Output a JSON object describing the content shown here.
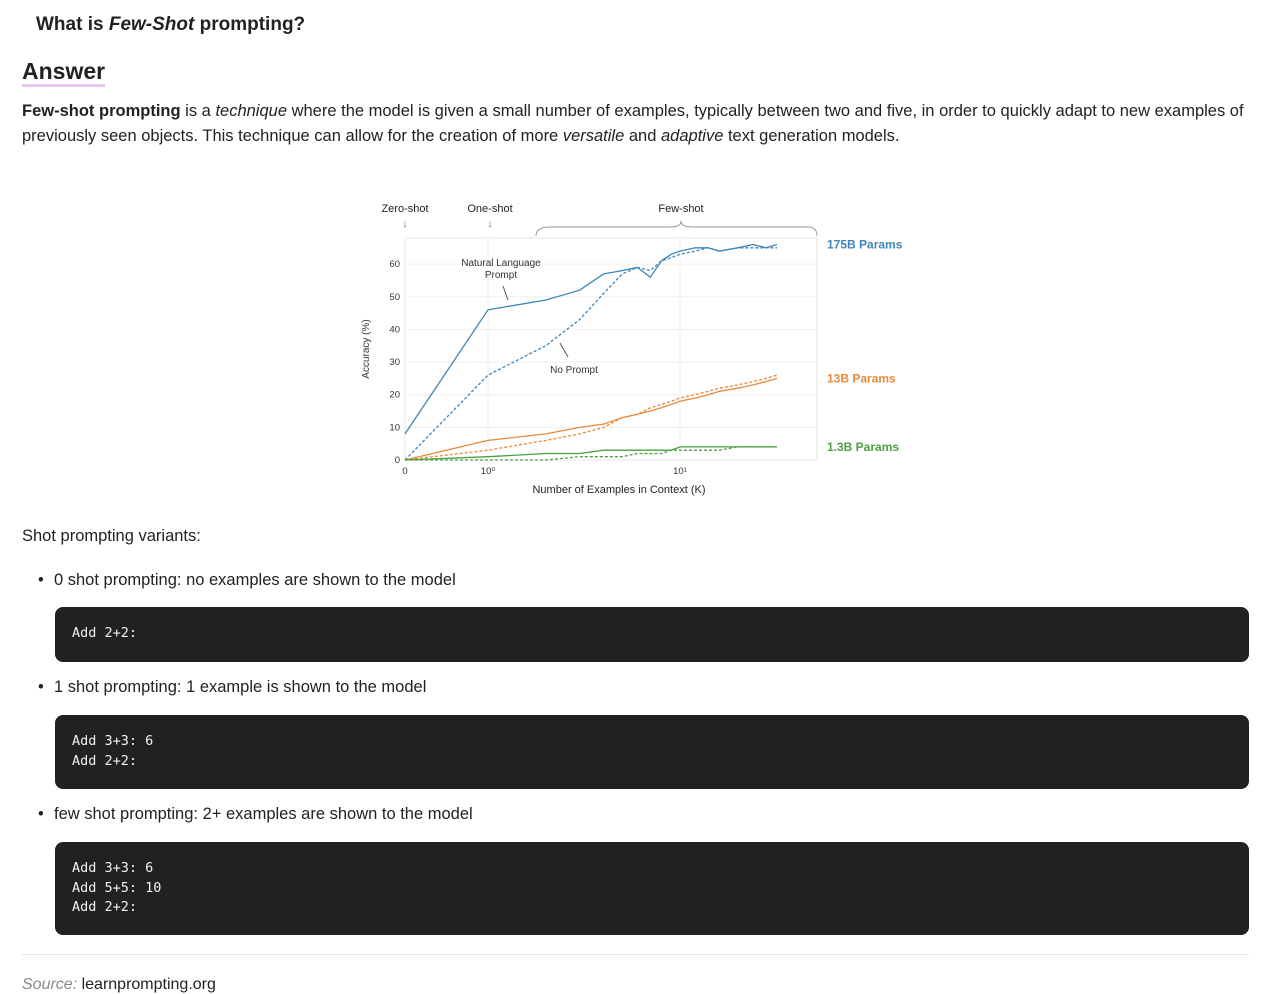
{
  "question": {
    "prefix": "What is ",
    "emphasis": "Few-Shot",
    "suffix": " prompting?"
  },
  "answer_heading": "Answer",
  "answer": {
    "p1_bold": "Few-shot prompting",
    "p1_a": " is a ",
    "p1_italic": "technique",
    "p1_b": " where the model is given a small number of examples, typically between two and five, in order to quickly adapt to new examples of previously seen objects. This technique can allow for the creation of more ",
    "p1_italic2": "versatile",
    "p1_c": " and ",
    "p1_italic3": "adaptive",
    "p1_d": " text generation models."
  },
  "chart_data": {
    "type": "line",
    "xlabel": "Number of Examples in Context (K)",
    "ylabel": "Accuracy (%)",
    "ylim": [
      0,
      68
    ],
    "x_scale": "log",
    "x_tick_labels": [
      "0",
      "10⁰",
      "10¹"
    ],
    "y_ticks": [
      0,
      10,
      20,
      30,
      40,
      50,
      60
    ],
    "top_labels": [
      "Zero-shot",
      "One-shot",
      "Few-shot"
    ],
    "annotations": [
      "Natural Language Prompt",
      "No Prompt"
    ],
    "series": [
      {
        "name": "175B Params",
        "color": "#3d85b8",
        "style": "solid",
        "x": [
          0,
          1,
          2,
          3,
          4,
          5,
          6,
          7,
          8,
          9,
          10,
          12,
          14,
          16,
          20,
          24,
          28,
          32
        ],
        "y": [
          8,
          46,
          49,
          52,
          57,
          58,
          59,
          56,
          61,
          63,
          64,
          65,
          65,
          64,
          65,
          66,
          65,
          66
        ]
      },
      {
        "name": "175B Params (no prompt)",
        "color": "#3d85b8",
        "style": "dashed",
        "x": [
          0,
          1,
          2,
          3,
          4,
          5,
          6,
          7,
          8,
          9,
          10,
          12,
          14,
          16,
          20,
          24,
          28,
          32
        ],
        "y": [
          0,
          26,
          35,
          43,
          51,
          57,
          59,
          58,
          61,
          62,
          63,
          64,
          65,
          64,
          65,
          65,
          65,
          65
        ]
      },
      {
        "name": "13B Params",
        "color": "#e8893a",
        "style": "solid",
        "x": [
          0,
          1,
          2,
          3,
          4,
          5,
          6,
          7,
          8,
          9,
          10,
          12,
          14,
          16,
          20,
          24,
          28,
          32
        ],
        "y": [
          0,
          6,
          8,
          10,
          11,
          13,
          14,
          15,
          16,
          17,
          18,
          19,
          20,
          21,
          22,
          23,
          24,
          25
        ]
      },
      {
        "name": "13B Params (no prompt)",
        "color": "#e8893a",
        "style": "dashed",
        "x": [
          0,
          1,
          2,
          3,
          4,
          5,
          6,
          7,
          8,
          9,
          10,
          12,
          14,
          16,
          20,
          24,
          28,
          32
        ],
        "y": [
          0,
          3,
          6,
          8,
          10,
          13,
          14,
          16,
          17,
          18,
          19,
          20,
          21,
          22,
          23,
          24,
          25,
          26
        ]
      },
      {
        "name": "1.3B Params",
        "color": "#4aa03f",
        "style": "solid",
        "x": [
          0,
          1,
          2,
          3,
          4,
          5,
          6,
          7,
          8,
          9,
          10,
          12,
          14,
          16,
          20,
          24,
          28,
          32
        ],
        "y": [
          0,
          1,
          2,
          2,
          3,
          3,
          3,
          3,
          3,
          3,
          4,
          4,
          4,
          4,
          4,
          4,
          4,
          4
        ]
      },
      {
        "name": "1.3B Params (no prompt)",
        "color": "#4aa03f",
        "style": "dashed",
        "x": [
          0,
          1,
          2,
          3,
          4,
          5,
          6,
          7,
          8,
          9,
          10,
          12,
          14,
          16,
          20,
          24,
          28,
          32
        ],
        "y": [
          0,
          0,
          0,
          1,
          1,
          1,
          2,
          2,
          2,
          3,
          3,
          3,
          3,
          3,
          4,
          4,
          4,
          4
        ]
      }
    ],
    "series_labels": [
      {
        "text": "175B Params",
        "color": "#3d85b8"
      },
      {
        "text": "13B Params",
        "color": "#e8893a"
      },
      {
        "text": "1.3B Params",
        "color": "#4aa03f"
      }
    ]
  },
  "variants_title": "Shot prompting variants:",
  "variants": [
    {
      "label": "0 shot prompting: no examples are shown to the model",
      "code": [
        "Add 2+2:"
      ]
    },
    {
      "label": "1 shot prompting: 1 example is shown to the model",
      "code": [
        "Add 3+3: 6",
        "Add 2+2:"
      ]
    },
    {
      "label": "few shot prompting: 2+ examples are shown to the model",
      "code": [
        "Add 3+3: 6",
        "Add 5+5: 10",
        "Add 2+2:"
      ]
    }
  ],
  "source": {
    "label": "Source: ",
    "value": "learnprompting.org"
  }
}
